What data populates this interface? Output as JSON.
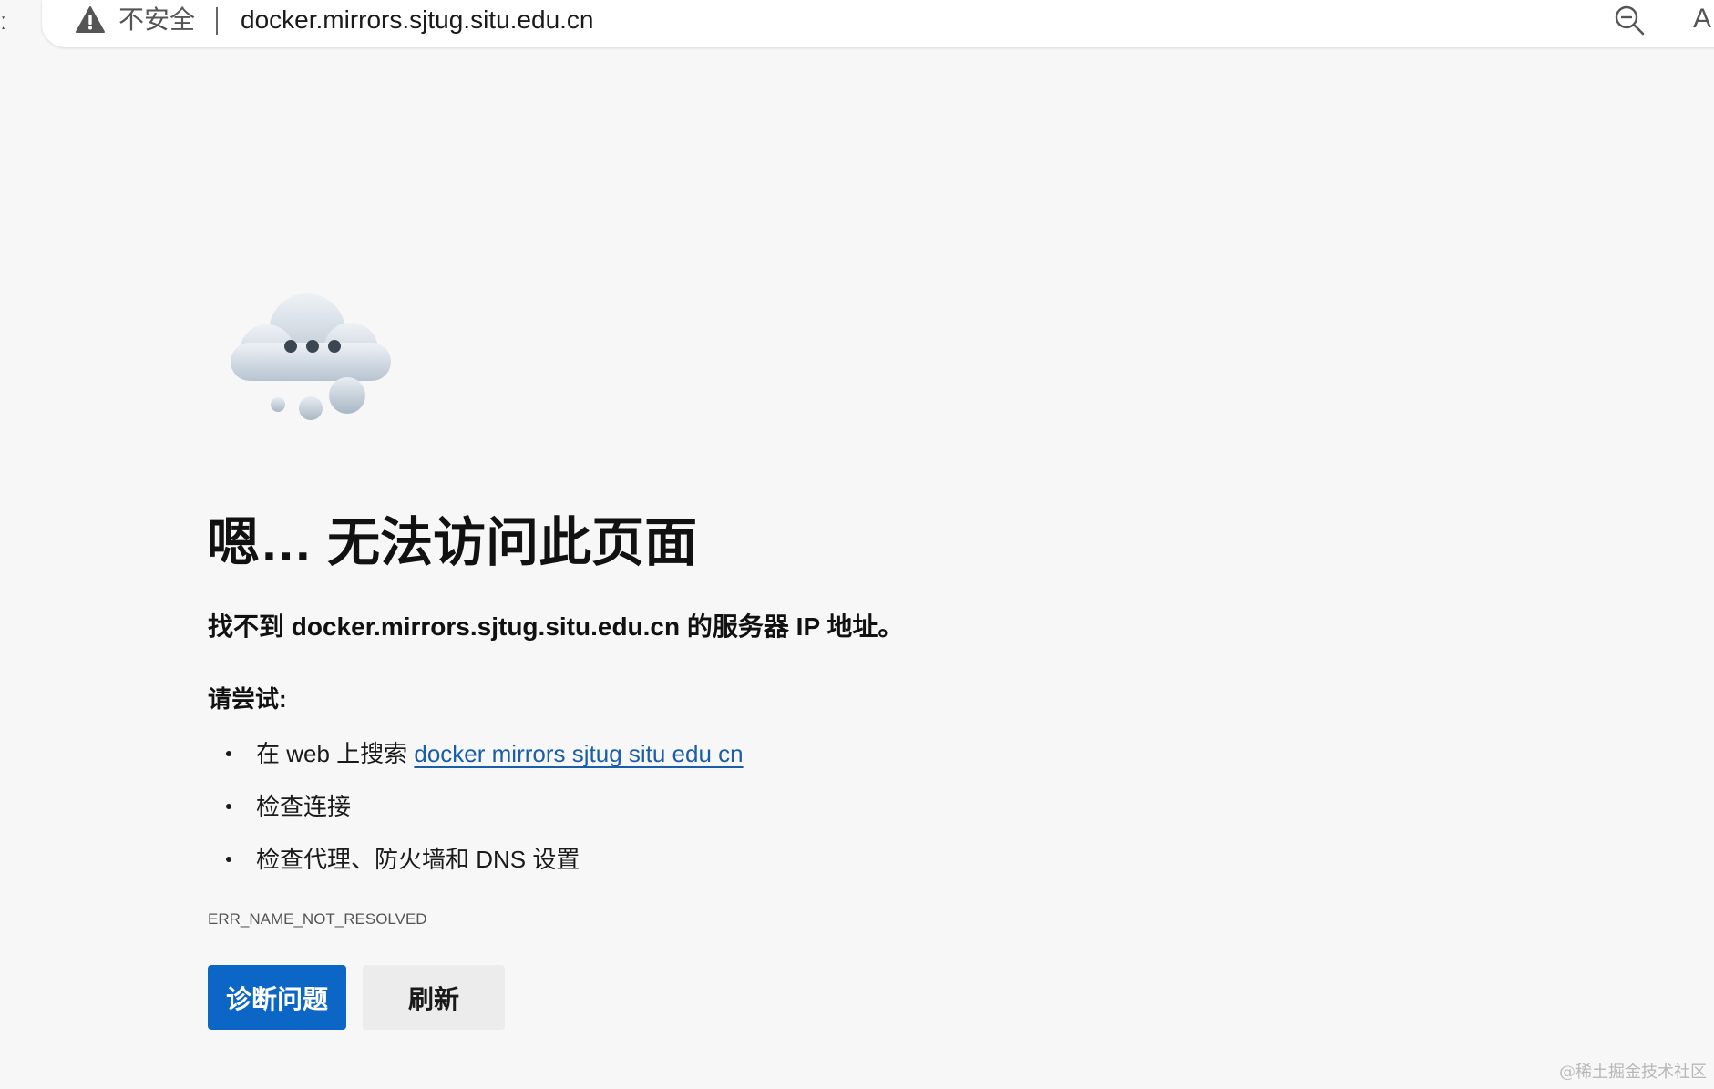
{
  "browser": {
    "security_label": "不安全",
    "url": "docker.mirrors.sjtug.situ.edu.cn",
    "read_aloud_glyph": "A",
    "icons": [
      "warning-icon",
      "zoom-icon",
      "read-aloud-icon"
    ]
  },
  "error_page": {
    "illustration": "cloud-icon",
    "headline": "嗯… 无法访问此页面",
    "subtitle": "找不到 docker.mirrors.sjtug.situ.edu.cn 的服务器 IP 地址。",
    "try_title": "请尝试:",
    "suggestions": {
      "search_prefix": "在 web 上搜索 ",
      "search_link": "docker mirrors sjtug situ edu cn",
      "check_connection": "检查连接",
      "check_proxy": "检查代理、防火墙和 DNS 设置"
    },
    "error_code": "ERR_NAME_NOT_RESOLVED",
    "buttons": {
      "diagnose": "诊断问题",
      "refresh": "刷新"
    }
  },
  "watermark": "@稀土掘金技术社区",
  "colors": {
    "page_background": "#f7f7f7",
    "primary_button": "#0c66c5",
    "secondary_button": "#ececec",
    "link": "#1b5ea8"
  }
}
